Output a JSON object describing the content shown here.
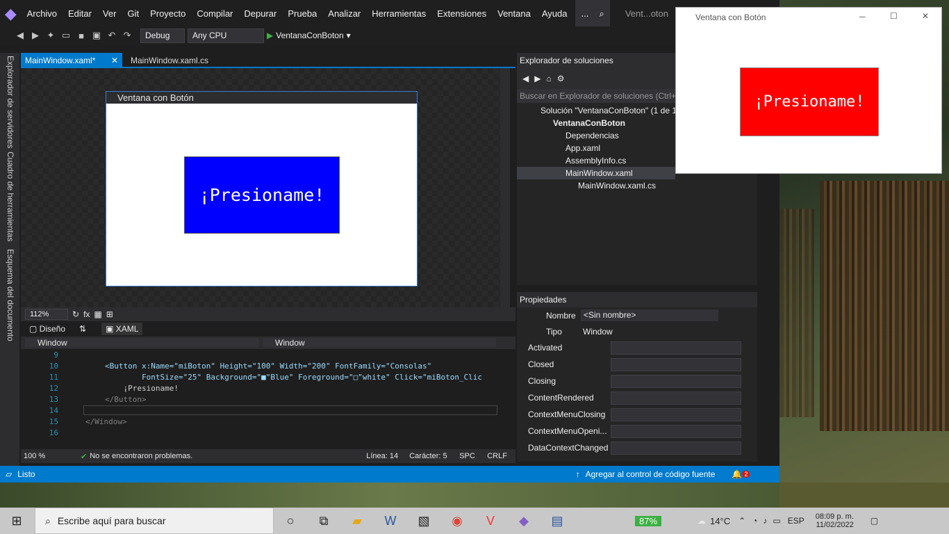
{
  "vs": {
    "menu": [
      "Archivo",
      "Editar",
      "Ver",
      "Git",
      "Proyecto",
      "Compilar",
      "Depurar",
      "Prueba",
      "Analizar",
      "Herramientas",
      "Extensiones",
      "Ventana",
      "Ayuda",
      "..."
    ],
    "title_short": "Vent...oton",
    "config": "Debug",
    "platform": "Any CPU",
    "run_target": "VentanaConBoton",
    "left_tabs": [
      "Explorador de servidores",
      "Cuadro de herramientas",
      "Esquema del documento"
    ],
    "tabs": [
      {
        "label": "MainWindow.xaml*"
      },
      {
        "label": "MainWindow.xaml.cs"
      }
    ],
    "designer": {
      "window_title": "Ventana con Botón",
      "button_text": "¡Presioname!",
      "button_color": "#0000ff"
    },
    "zoom": "112%",
    "split": {
      "design": "Diseño",
      "xaml": "XAML"
    },
    "nav": {
      "left": "Window",
      "right": "Window"
    },
    "code": {
      "lines": [
        "9",
        "10",
        "11",
        "12",
        "13",
        "14",
        "15",
        "16"
      ],
      "l10": "<Button x:Name=\"miBoton\" Height=\"100\" Width=\"200\" FontFamily=\"Consolas\"",
      "l11": "        FontSize=\"25\" Background=\"■\"Blue\" Foreground=\"□\"white\" Click=\"miBoton_Clic",
      "l12": "    ¡Presioname!",
      "l13": "</Button>",
      "l15": "</Window>"
    },
    "editor_status": {
      "zoom": "100 %",
      "issues": "No se encontraron problemas.",
      "line": "Línea: 14",
      "char": "Carácter: 5",
      "spc": "SPC",
      "crlf": "CRLF"
    },
    "solution_explorer": {
      "title": "Explorador de soluciones",
      "search": "Buscar en Explorador de soluciones (Ctrl+",
      "items": [
        "Solución \"VentanaConBoton\" (1 de 1",
        "VentanaConBoton",
        "Dependencias",
        "App.xaml",
        "AssemblyInfo.cs",
        "MainWindow.xaml",
        "MainWindow.xaml.cs"
      ]
    },
    "properties": {
      "title": "Propiedades",
      "name_label": "Nombre",
      "name_value": "<Sin nombre>",
      "type_label": "Tipo",
      "type_value": "Window",
      "events": [
        "Activated",
        "Closed",
        "Closing",
        "ContentRendered",
        "ContextMenuClosing",
        "ContextMenuOpeni...",
        "DataContextChanged"
      ]
    },
    "status": {
      "ready": "Listo",
      "source_control": "Agregar al control de código fuente",
      "notifications": "2"
    }
  },
  "running_window": {
    "title": "Ventana con Botón",
    "button_text": "¡Presioname!",
    "button_color": "#ff0000"
  },
  "taskbar": {
    "search_placeholder": "Escribe aquí para buscar",
    "battery": "87%",
    "temperature": "14°C",
    "lang": "ESP",
    "time": "08:09 p. m.",
    "date": "11/02/2022"
  }
}
